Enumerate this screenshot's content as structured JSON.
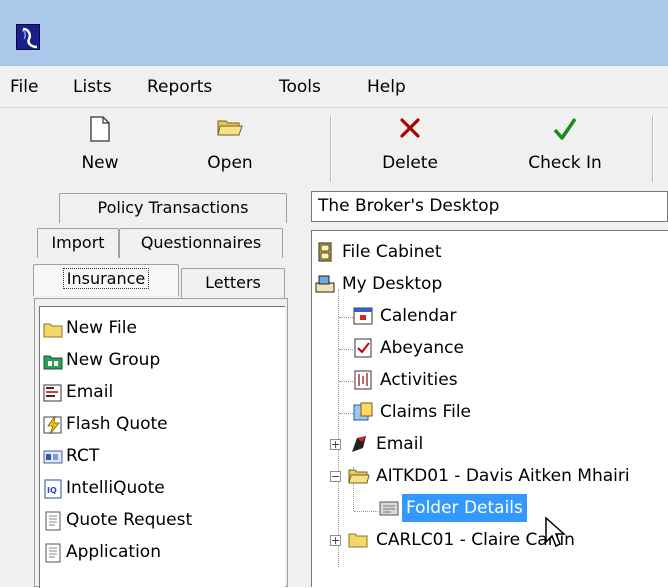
{
  "colors": {
    "titlebar": "#a9c8ea",
    "chrome": "#f0f0f0",
    "selection": "#3399ff",
    "delete_icon": "#b00000",
    "checkin_icon": "#1a8a1a"
  },
  "menu": [
    {
      "label": "File"
    },
    {
      "label": "Lists"
    },
    {
      "label": "Reports"
    },
    {
      "label": "Tools"
    },
    {
      "label": "Help"
    }
  ],
  "toolbar": {
    "new": {
      "label": "New",
      "icon": "new-document-icon"
    },
    "open": {
      "label": "Open",
      "icon": "open-folder-icon"
    },
    "delete": {
      "label": "Delete",
      "icon": "delete-x-icon"
    },
    "checkin": {
      "label": "Check In",
      "icon": "checkmark-icon"
    }
  },
  "tabs": {
    "row1": [
      {
        "label": "Policy Transactions"
      }
    ],
    "row2": [
      {
        "label": "Import"
      },
      {
        "label": "Questionnaires"
      }
    ],
    "row3": [
      {
        "label": "Insurance",
        "active": true
      },
      {
        "label": "Letters"
      }
    ]
  },
  "left_list": [
    {
      "label": "New File",
      "icon": "folder-icon"
    },
    {
      "label": "New Group",
      "icon": "group-folder-icon"
    },
    {
      "label": "Email",
      "icon": "email-icon"
    },
    {
      "label": "Flash Quote",
      "icon": "flash-icon"
    },
    {
      "label": "RCT",
      "icon": "rct-icon"
    },
    {
      "label": "IntelliQuote",
      "icon": "intelliquote-icon"
    },
    {
      "label": "Quote Request",
      "icon": "form-icon"
    },
    {
      "label": "Application",
      "icon": "form-icon"
    }
  ],
  "address": "The Broker's Desktop",
  "tree": [
    {
      "label": "File Cabinet",
      "icon": "file-cabinet-icon"
    },
    {
      "label": "My Desktop",
      "icon": "desktop-icon"
    },
    {
      "label": "Calendar",
      "icon": "calendar-icon"
    },
    {
      "label": "Abeyance",
      "icon": "abeyance-icon"
    },
    {
      "label": "Activities",
      "icon": "activities-icon"
    },
    {
      "label": "Claims File",
      "icon": "claims-icon"
    },
    {
      "label": "Email",
      "icon": "email-icon",
      "expander": "+"
    },
    {
      "label": "AITKD01 - Davis Aitken Mhairi",
      "icon": "open-folder-icon",
      "expander": "−"
    },
    {
      "label": "Folder Details",
      "icon": "folder-details-icon",
      "selected": true
    },
    {
      "label": "CARLC01 - Claire Carlin",
      "icon": "folder-icon",
      "expander": "+"
    }
  ]
}
